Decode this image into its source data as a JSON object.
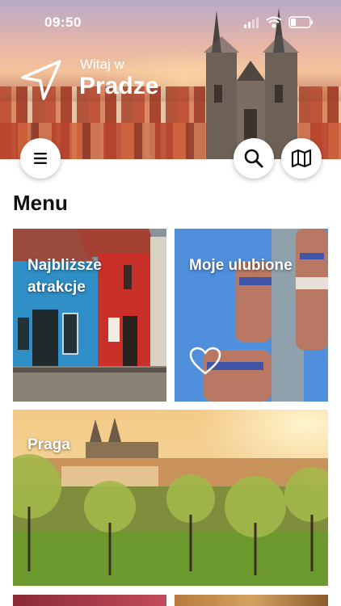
{
  "status_bar": {
    "time": "09:50"
  },
  "header": {
    "welcome_small": "Witaj w",
    "welcome_city": "Pradze"
  },
  "buttons": {
    "menu_icon": "hamburger-menu-icon",
    "search_icon": "search-icon",
    "map_icon": "map-icon"
  },
  "section": {
    "title": "Menu"
  },
  "tiles": [
    {
      "label_line1": "Najbliższe",
      "label_line2": "atrakcje"
    },
    {
      "label": "Moje ulubione",
      "icon": "heart-icon"
    },
    {
      "label": "Praga"
    }
  ],
  "colors": {
    "accent": "#ffffff",
    "text": "#111111"
  }
}
